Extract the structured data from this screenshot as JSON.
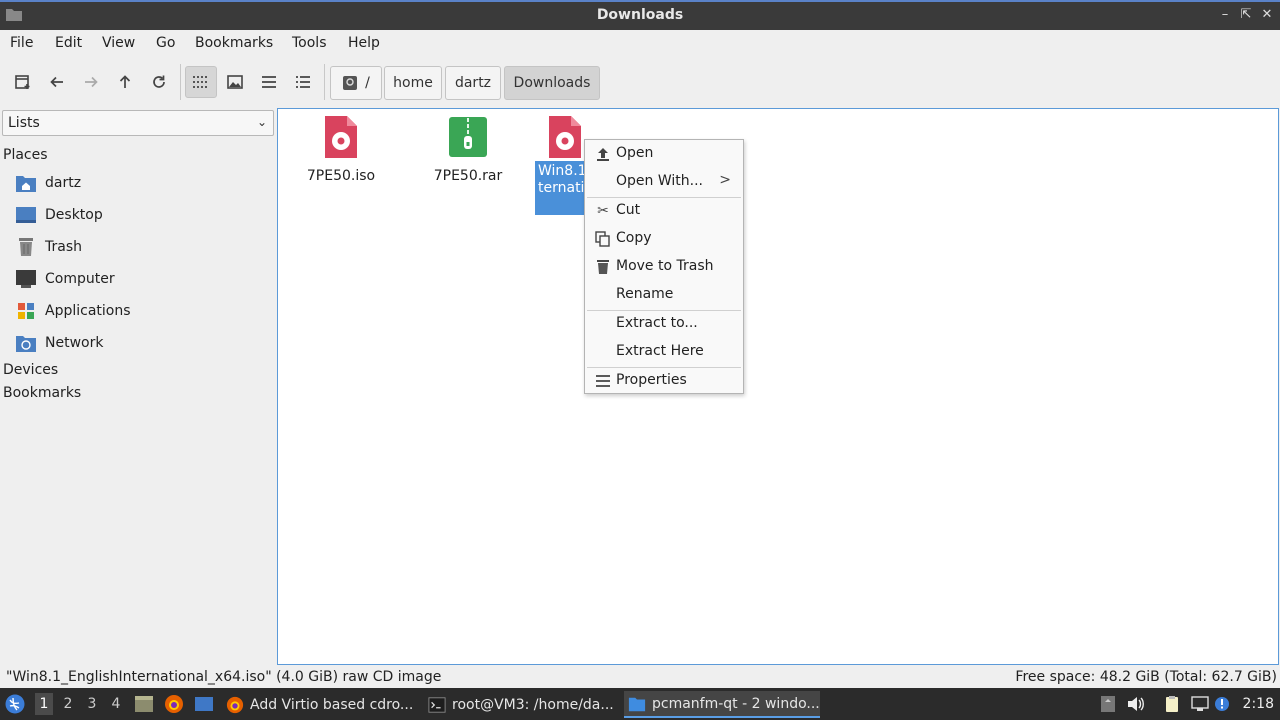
{
  "window": {
    "title": "Downloads"
  },
  "menubar": {
    "items": [
      "File",
      "Edit",
      "View",
      "Go",
      "Bookmarks",
      "Tools",
      "Help"
    ]
  },
  "toolbar": {
    "buttons": [
      "new-tab",
      "back",
      "forward",
      "up",
      "reload",
      "icon-view",
      "thumbnail-view",
      "compact-view",
      "detailed-list-view"
    ],
    "breadcrumbs": [
      "/",
      "home",
      "dartz",
      "Downloads"
    ]
  },
  "sidebar": {
    "combo_value": "Lists",
    "places_heading": "Places",
    "places": [
      {
        "label": "dartz",
        "icon": "home-folder-icon"
      },
      {
        "label": "Desktop",
        "icon": "desktop-icon"
      },
      {
        "label": "Trash",
        "icon": "trash-icon"
      },
      {
        "label": "Computer",
        "icon": "computer-icon"
      },
      {
        "label": "Applications",
        "icon": "applications-icon"
      },
      {
        "label": "Network",
        "icon": "network-icon"
      }
    ],
    "devices_heading": "Devices",
    "bookmarks_heading": "Bookmarks"
  },
  "files": [
    {
      "name": "7PE50.iso",
      "icon": "disc-image-icon",
      "color": "#d9435e"
    },
    {
      "name": "7PE50.rar",
      "icon": "archive-icon",
      "color": "#3aa655"
    },
    {
      "name_visible_line1": "Win8.1",
      "name_visible_line2": "ternati",
      "icon": "disc-image-icon",
      "selected": true
    }
  ],
  "context_menu": {
    "items": [
      {
        "label": "Open",
        "icon": "open-icon"
      },
      {
        "label": "Open With...",
        "submenu": ">"
      },
      {
        "label": "Cut",
        "icon": "cut-icon"
      },
      {
        "label": "Copy",
        "icon": "copy-icon"
      },
      {
        "label": "Move to Trash",
        "icon": "trash-icon"
      },
      {
        "label": "Rename"
      },
      {
        "label": "Extract to..."
      },
      {
        "label": "Extract Here"
      },
      {
        "label": "Properties",
        "icon": "properties-icon"
      }
    ]
  },
  "statusbar": {
    "left": "\"Win8.1_EnglishInternational_x64.iso\" (4.0 GiB) raw CD image",
    "right": "Free space: 48.2 GiB (Total: 62.7 GiB)"
  },
  "taskbar": {
    "desktops": [
      "1",
      "2",
      "3",
      "4"
    ],
    "active_desktop": "1",
    "tasks": [
      {
        "label": "Add Virtio based cdro...",
        "icon": "firefox-icon"
      },
      {
        "label": "root@VM3: /home/da...",
        "icon": "terminal-icon"
      },
      {
        "label": "pcmanfm-qt - 2 windo...",
        "icon": "folder-icon",
        "active": true
      }
    ],
    "clock": "2:18"
  },
  "colors": {
    "accent": "#4a90d9",
    "iso": "#d9435e",
    "rar": "#3aa655"
  }
}
